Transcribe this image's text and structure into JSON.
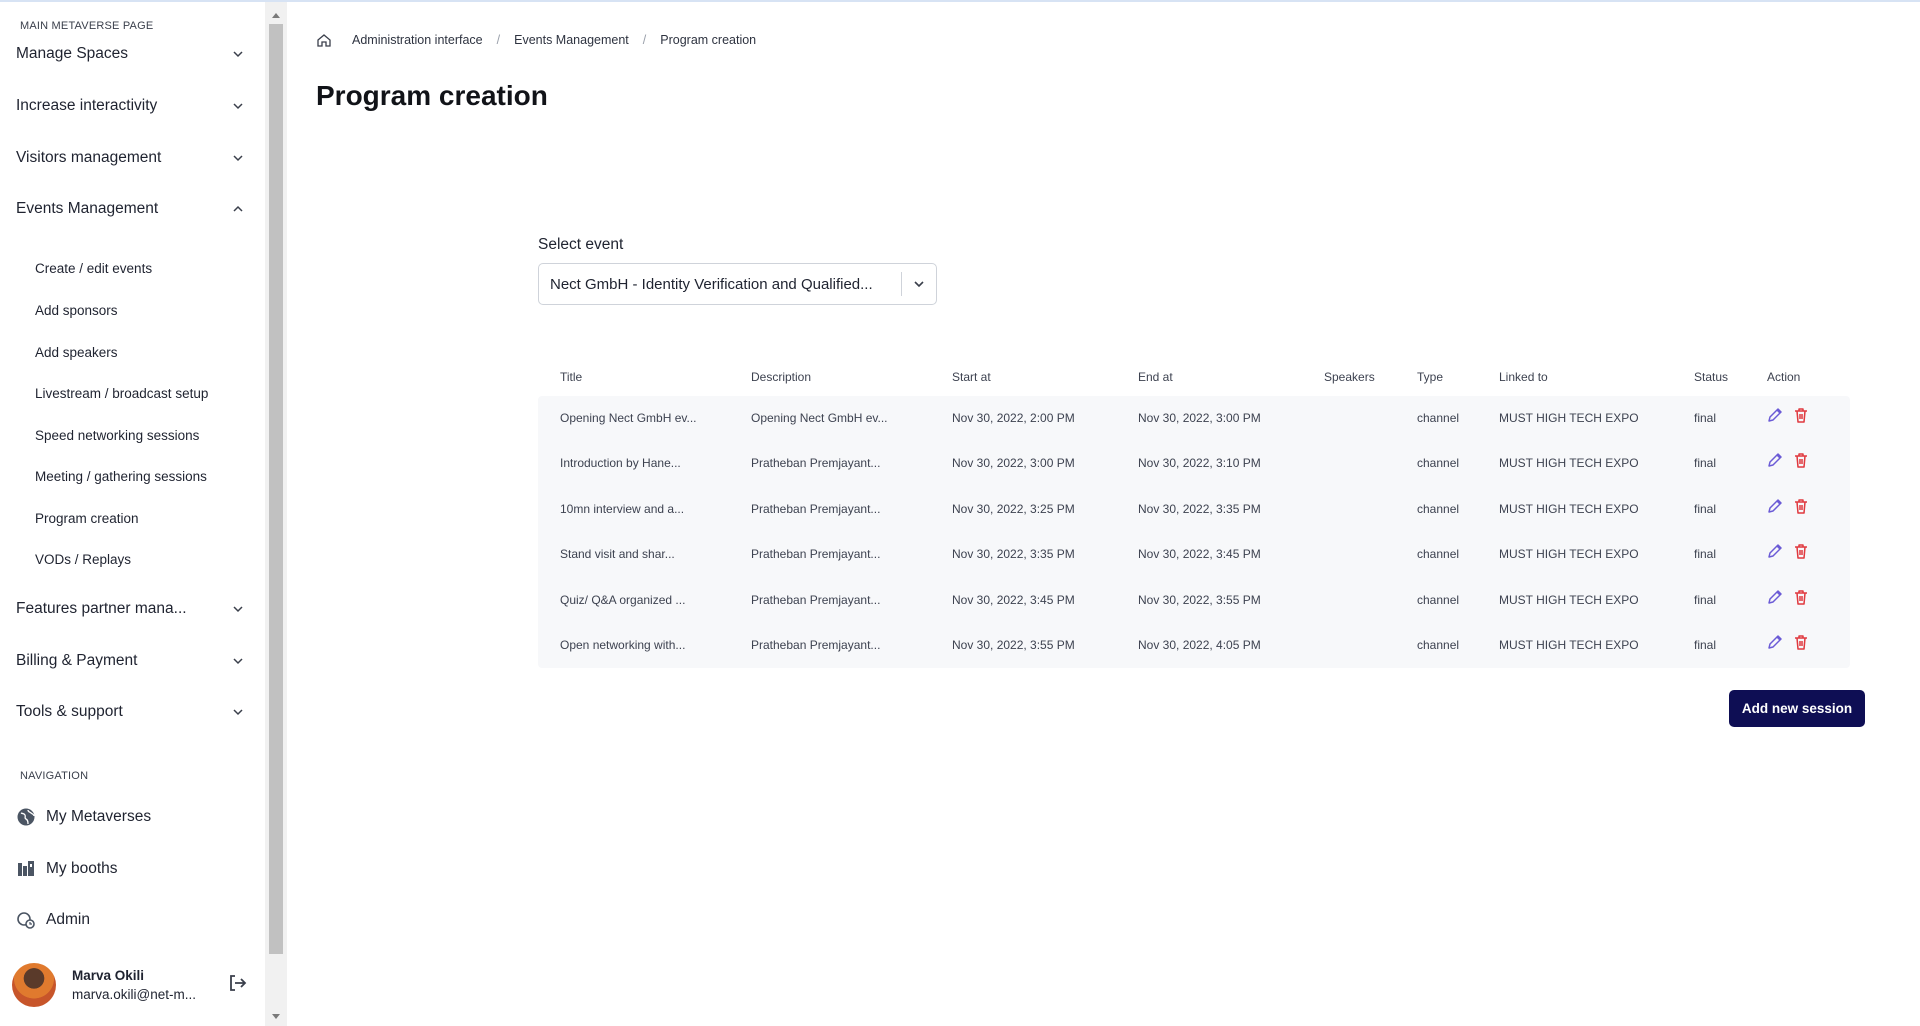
{
  "sidebar": {
    "main_heading": "MAIN METAVERSE PAGE",
    "sections": [
      {
        "label": "Manage Spaces",
        "expanded": false
      },
      {
        "label": "Increase interactivity",
        "expanded": false
      },
      {
        "label": "Visitors management",
        "expanded": false
      },
      {
        "label": "Events Management",
        "expanded": true
      },
      {
        "label": "Features partner mana...",
        "expanded": false
      },
      {
        "label": "Billing & Payment",
        "expanded": false
      },
      {
        "label": "Tools & support",
        "expanded": false
      }
    ],
    "events_subitems": [
      "Create / edit events",
      "Add sponsors",
      "Add speakers",
      "Livestream / broadcast setup",
      "Speed networking sessions",
      "Meeting / gathering sessions",
      "Program creation",
      "VODs / Replays"
    ],
    "nav_heading": "NAVIGATION",
    "nav_items": [
      {
        "label": "My Metaverses",
        "icon": "globe-icon"
      },
      {
        "label": "My booths",
        "icon": "booth-icon"
      },
      {
        "label": "Admin",
        "icon": "admin-icon"
      }
    ],
    "user": {
      "name": "Marva Okili",
      "email": "marva.okili@net-m..."
    }
  },
  "breadcrumb": [
    "Administration interface",
    "Events Management",
    "Program creation"
  ],
  "page_title": "Program creation",
  "event_select": {
    "label": "Select event",
    "value": "Nect GmbH - Identity Verification and Qualified..."
  },
  "table": {
    "columns": [
      "Title",
      "Description",
      "Start at",
      "End at",
      "Speakers",
      "Type",
      "Linked to",
      "Status",
      "Action"
    ],
    "rows": [
      {
        "title": "Opening Nect GmbH ev...",
        "description": "Opening Nect GmbH ev...",
        "start": "Nov 30, 2022, 2:00 PM",
        "end": "Nov 30, 2022, 3:00 PM",
        "speakers": "",
        "type": "channel",
        "linked": "MUST HIGH TECH EXPO",
        "status": "final"
      },
      {
        "title": "Introduction by Hane...",
        "description": "Pratheban Premjayant...",
        "start": "Nov 30, 2022, 3:00 PM",
        "end": "Nov 30, 2022, 3:10 PM",
        "speakers": "",
        "type": "channel",
        "linked": "MUST HIGH TECH EXPO",
        "status": "final"
      },
      {
        "title": "10mn interview and a...",
        "description": "Pratheban Premjayant...",
        "start": "Nov 30, 2022, 3:25 PM",
        "end": "Nov 30, 2022, 3:35 PM",
        "speakers": "",
        "type": "channel",
        "linked": "MUST HIGH TECH EXPO",
        "status": "final"
      },
      {
        "title": "Stand visit and shar...",
        "description": "Pratheban Premjayant...",
        "start": "Nov 30, 2022, 3:35 PM",
        "end": "Nov 30, 2022, 3:45 PM",
        "speakers": "",
        "type": "channel",
        "linked": "MUST HIGH TECH EXPO",
        "status": "final"
      },
      {
        "title": "Quiz/ Q&A organized ...",
        "description": "Pratheban Premjayant...",
        "start": "Nov 30, 2022, 3:45 PM",
        "end": "Nov 30, 2022, 3:55 PM",
        "speakers": "",
        "type": "channel",
        "linked": "MUST HIGH TECH EXPO",
        "status": "final"
      },
      {
        "title": "Open networking with...",
        "description": "Pratheban Premjayant...",
        "start": "Nov 30, 2022, 3:55 PM",
        "end": "Nov 30, 2022, 4:05 PM",
        "speakers": "",
        "type": "channel",
        "linked": "MUST HIGH TECH EXPO",
        "status": "final"
      }
    ]
  },
  "add_button_label": "Add new session",
  "colors": {
    "primary_button": "#0e0e54",
    "edit_icon": "#6b5bd6",
    "delete_icon": "#e0393e",
    "row_bg": "#f7f8fa"
  }
}
